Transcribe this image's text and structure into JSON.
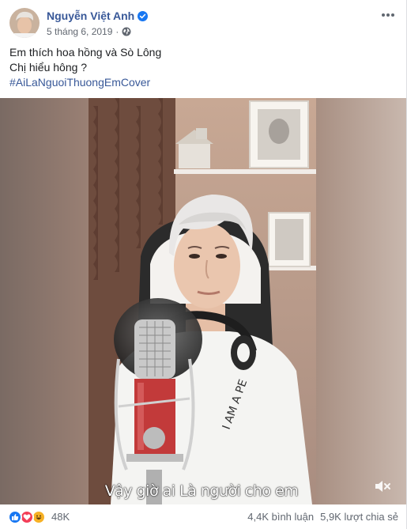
{
  "post": {
    "author": "Nguyễn Việt Anh",
    "date": "5 tháng 6, 2019",
    "separator": "·",
    "text_line1": "Em thích hoa hồng và Sò Lông",
    "text_line2": "Chị hiểu hông ?",
    "hashtag": "#AiLaNguoiThuongEmCover"
  },
  "video": {
    "caption": "Vậy giờ ai Là người cho em",
    "muted": true
  },
  "footer": {
    "reaction_count": "48K",
    "comments": "4,4K bình luận",
    "shares": "5,9K lượt chia sẻ"
  },
  "colors": {
    "link": "#385898",
    "verified": "#1877f2",
    "like": "#1877f2",
    "love": "#f33e58",
    "haha": "#f7b125"
  }
}
